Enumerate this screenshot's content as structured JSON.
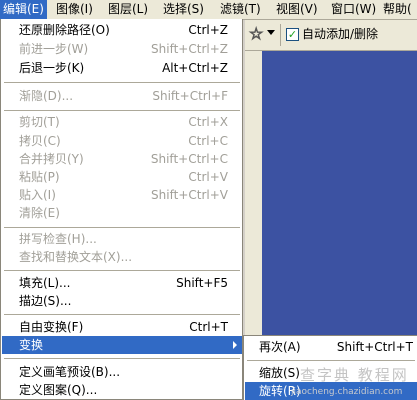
{
  "menubar": [
    {
      "label": "编辑(E)",
      "active": true
    },
    {
      "label": "图像(I)"
    },
    {
      "label": "图层(L)"
    },
    {
      "label": "选择(S)"
    },
    {
      "label": "滤镜(T)"
    },
    {
      "label": "视图(V)"
    },
    {
      "label": "窗口(W)"
    },
    {
      "label": "帮助("
    }
  ],
  "toolbar": {
    "auto_add_remove_label": "自动添加/删除",
    "auto_add_remove_checked": true
  },
  "edit_menu": {
    "items": [
      {
        "label": "还原删除路径(O)",
        "shortcut": "Ctrl+Z"
      },
      {
        "label": "前进一步(W)",
        "shortcut": "Shift+Ctrl+Z",
        "disabled": true
      },
      {
        "label": "后退一步(K)",
        "shortcut": "Alt+Ctrl+Z"
      },
      {
        "label": "渐隐(D)...",
        "shortcut": "Shift+Ctrl+F",
        "disabled": true
      },
      {
        "label": "剪切(T)",
        "shortcut": "Ctrl+X",
        "disabled": true
      },
      {
        "label": "拷贝(C)",
        "shortcut": "Ctrl+C",
        "disabled": true
      },
      {
        "label": "合并拷贝(Y)",
        "shortcut": "Shift+Ctrl+C",
        "disabled": true
      },
      {
        "label": "粘贴(P)",
        "shortcut": "Ctrl+V",
        "disabled": true
      },
      {
        "label": "贴入(I)",
        "shortcut": "Shift+Ctrl+V",
        "disabled": true
      },
      {
        "label": "清除(E)",
        "shortcut": "",
        "disabled": true
      },
      {
        "label": "拼写检查(H)...",
        "shortcut": "",
        "disabled": true
      },
      {
        "label": "查找和替换文本(X)...",
        "shortcut": "",
        "disabled": true
      },
      {
        "label": "填充(L)...",
        "shortcut": "Shift+F5"
      },
      {
        "label": "描边(S)...",
        "shortcut": ""
      },
      {
        "label": "自由变换(F)",
        "shortcut": "Ctrl+T"
      },
      {
        "label": "变换",
        "shortcut": "",
        "highlighted": true,
        "has_submenu": true
      },
      {
        "label": "定义画笔预设(B)...",
        "shortcut": ""
      },
      {
        "label": "定义图案(Q)...",
        "shortcut": ""
      }
    ]
  },
  "transform_submenu": {
    "items": [
      {
        "label": "再次(A)",
        "shortcut": "Shift+Ctrl+T"
      },
      {
        "label": "缩放(S)",
        "shortcut": ""
      },
      {
        "label": "旋转(R)",
        "shortcut": "",
        "highlighted": true
      }
    ]
  },
  "watermark": {
    "text": "查字典 教程网",
    "url": "jiaocheng.chazidian.com"
  }
}
